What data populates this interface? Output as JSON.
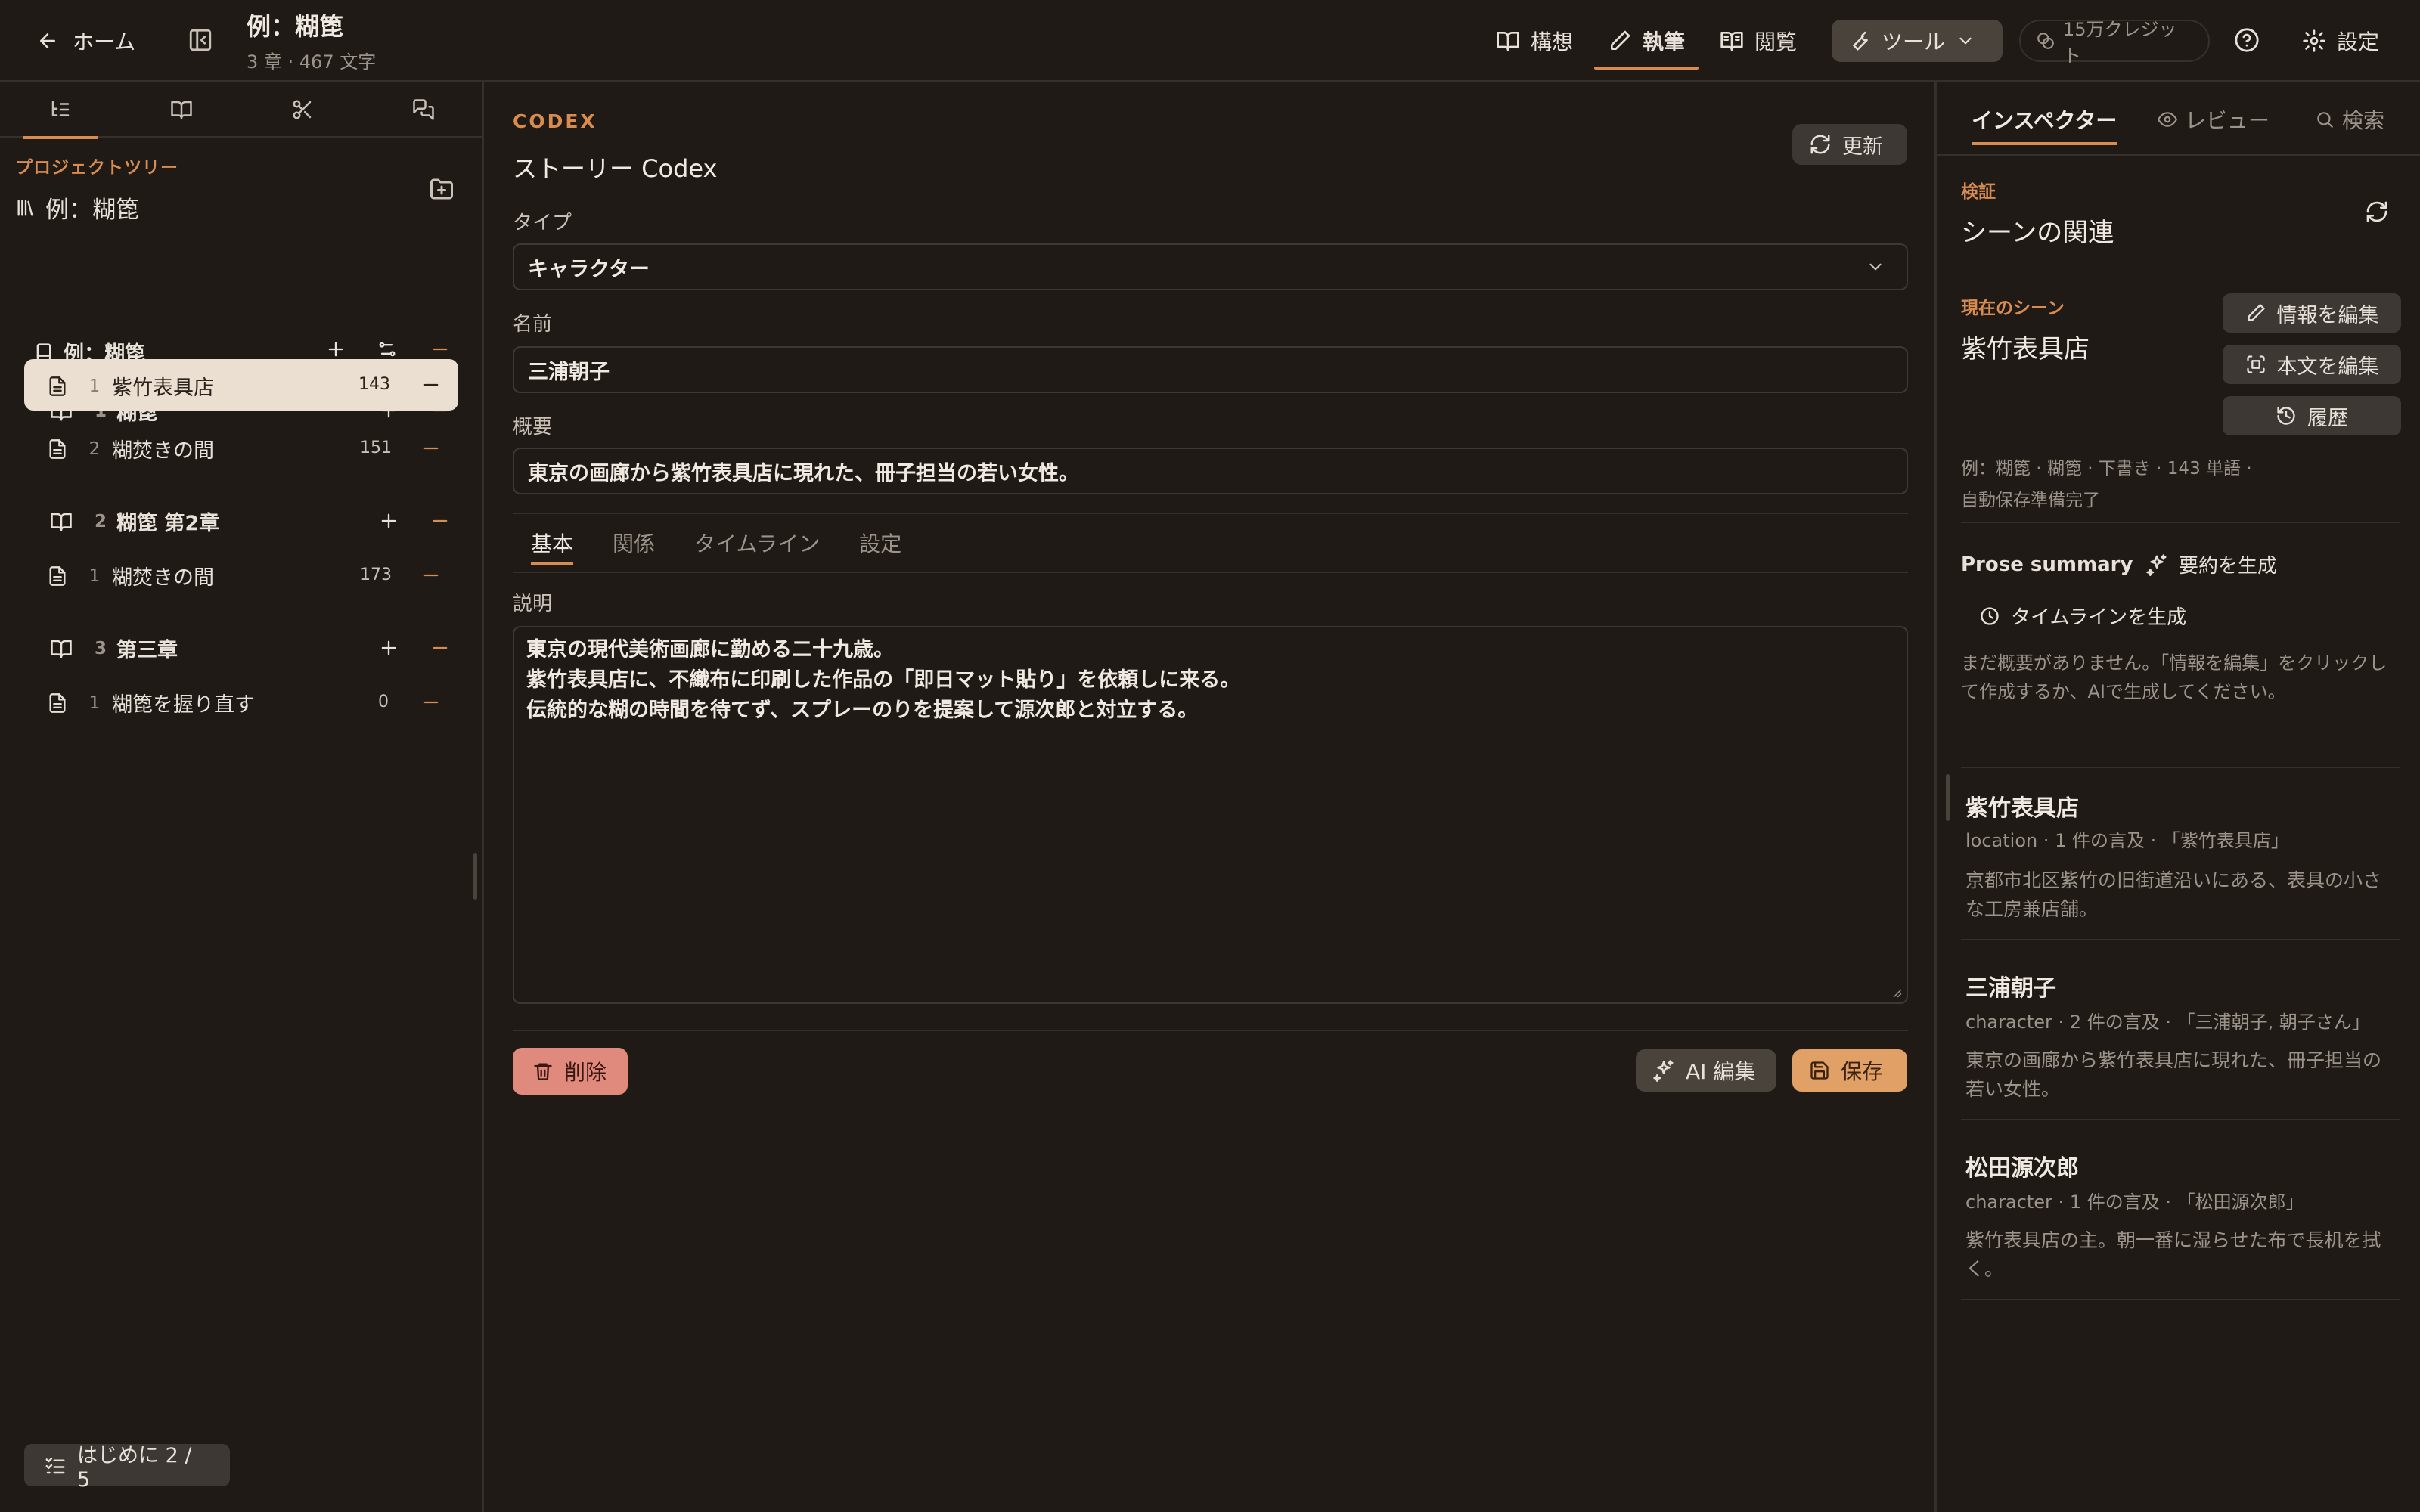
{
  "header": {
    "home_label": "ホーム",
    "project_title": "例：糊箆",
    "project_sub": "3 章 · 467 文字",
    "modes": [
      {
        "label": "構想",
        "icon": "book-open-icon"
      },
      {
        "label": "執筆",
        "icon": "pen-icon",
        "active": true
      },
      {
        "label": "閲覧",
        "icon": "book-reader-icon"
      }
    ],
    "tools_label": "ツール",
    "credits_label": "15万クレジット",
    "settings_label": "設定"
  },
  "sidebar": {
    "tree_label": "プロジェクトツリー",
    "project_name": "例：糊箆",
    "root": {
      "label": "例：糊箆"
    },
    "chapters": [
      {
        "num": "1",
        "label": "糊箆",
        "scenes": [
          {
            "num": "1",
            "label": "紫竹表具店",
            "count": "143",
            "selected": true
          },
          {
            "num": "2",
            "label": "糊焚きの間",
            "count": "151"
          }
        ]
      },
      {
        "num": "2",
        "label": "糊箆 第2章",
        "scenes": [
          {
            "num": "1",
            "label": "糊焚きの間",
            "count": "173"
          }
        ]
      },
      {
        "num": "3",
        "label": "第三章",
        "scenes": [
          {
            "num": "1",
            "label": "糊箆を握り直す",
            "count": "0"
          }
        ]
      }
    ],
    "guide_label": "はじめに 2 / 5"
  },
  "codex": {
    "section_label": "CODEX",
    "title": "ストーリー Codex",
    "refresh_label": "更新",
    "type_label": "タイプ",
    "type_value": "キャラクター",
    "name_label": "名前",
    "name_value": "三浦朝子",
    "summary_label": "概要",
    "summary_value": "東京の画廊から紫竹表具店に現れた、冊子担当の若い女性。",
    "tabs": [
      "基本",
      "関係",
      "タイムライン",
      "設定"
    ],
    "desc_label": "説明",
    "desc_lines": [
      "東京の現代美術画廊に勤める二十九歳。",
      "紫竹表具店に、不織布に印刷した作品の「即日マット貼り」を依頼しに来る。",
      "伝統的な糊の時間を待てず、スプレーのりを提案して源次郎と対立する。"
    ],
    "delete_label": "削除",
    "ai_edit_label": "AI 編集",
    "save_label": "保存"
  },
  "inspector": {
    "tabs": [
      "インスペクター",
      "レビュー",
      "検索"
    ],
    "verify_label": "検証",
    "scene_relation_title": "シーンの関連",
    "current_scene_label": "現在のシーン",
    "current_scene": "紫竹表具店",
    "edit_info_label": "情報を編集",
    "edit_text_label": "本文を編集",
    "history_label": "履歴",
    "meta_line1": "例：糊箆 · 糊箆 · 下書き · 143 単語 ·",
    "meta_line2": "自動保存準備完了",
    "prose_summary_label": "Prose summary",
    "gen_summary_label": "要約を生成",
    "gen_timeline_label": "タイムラインを生成",
    "no_summary_note": "まだ概要がありません。「情報を編集」をクリックして作成するか、AIで生成してください。",
    "entries": [
      {
        "name": "紫竹表具店",
        "meta": "location · 1 件の言及 · 「紫竹表具店」",
        "desc": "京都市北区紫竹の旧街道沿いにある、表具の小さな工房兼店舗。"
      },
      {
        "name": "三浦朝子",
        "meta": "character · 2 件の言及 · 「三浦朝子, 朝子さん」",
        "desc": "東京の画廊から紫竹表具店に現れた、冊子担当の若い女性。"
      },
      {
        "name": "松田源次郎",
        "meta": "character · 1 件の言及 · 「松田源次郎」",
        "desc": "紫竹表具店の主。朝一番に湿らせた布で長机を拭く。"
      }
    ]
  },
  "colors": {
    "background": "#1f1a16",
    "accent": "#d98c4f",
    "selected_row": "#eadfd0",
    "delete": "#e08a7d",
    "save": "#e0a066"
  }
}
